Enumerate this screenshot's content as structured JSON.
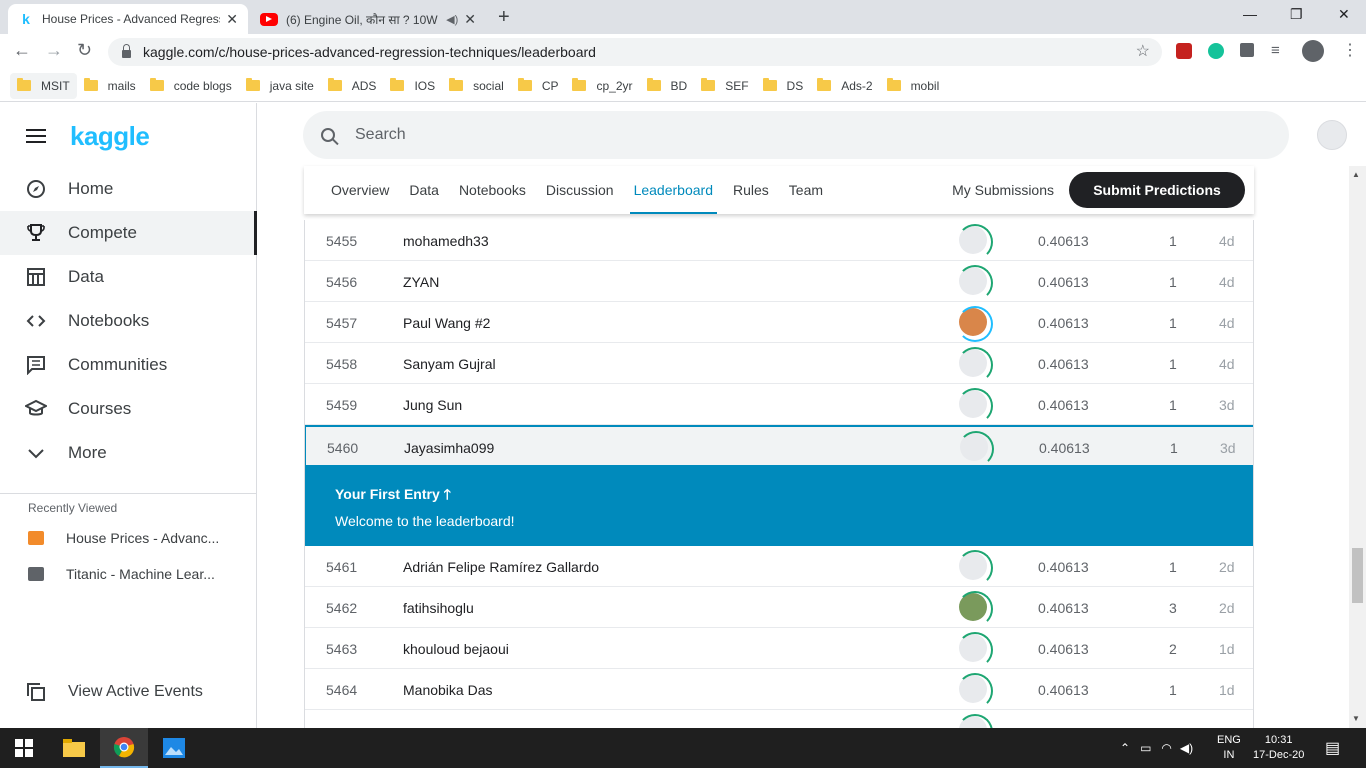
{
  "browser": {
    "tabs": [
      {
        "title": "House Prices - Advanced Regress",
        "favicon": "kaggle-k-icon",
        "active": true
      },
      {
        "title": "(6) Engine Oil, कौन सा ? 10W",
        "favicon": "youtube-icon",
        "active": false
      }
    ],
    "url": "kaggle.com/c/house-prices-advanced-regression-techniques/leaderboard",
    "bookmarks": [
      "MSIT",
      "mails",
      "code blogs",
      "java site",
      "ADS",
      "IOS",
      "social",
      "CP",
      "cp_2yr",
      "BD",
      "SEF",
      "DS",
      "Ads-2",
      "mobil"
    ]
  },
  "sidebar": {
    "logo": "kaggle",
    "items": [
      {
        "label": "Home",
        "icon": "compass-icon"
      },
      {
        "label": "Compete",
        "icon": "trophy-icon",
        "selected": true
      },
      {
        "label": "Data",
        "icon": "table-icon"
      },
      {
        "label": "Notebooks",
        "icon": "code-icon"
      },
      {
        "label": "Communities",
        "icon": "forum-icon"
      },
      {
        "label": "Courses",
        "icon": "school-icon"
      },
      {
        "label": "More",
        "icon": "chevron-down-icon"
      }
    ],
    "recently_viewed_heading": "Recently Viewed",
    "recent": [
      "House Prices - Advanc...",
      "Titanic - Machine Lear..."
    ],
    "view_active_events": "View Active Events"
  },
  "search": {
    "placeholder": "Search"
  },
  "competition_tabs": [
    "Overview",
    "Data",
    "Notebooks",
    "Discussion",
    "Leaderboard",
    "Rules",
    "Team"
  ],
  "active_tab": "Leaderboard",
  "my_submissions": "My Submissions",
  "submit_predictions": "Submit Predictions",
  "leaderboard": {
    "rows_before": [
      {
        "rank": "5455",
        "name": "mohamedh33",
        "score": "0.40613",
        "entries": "1",
        "last": "4d",
        "avatar": "default"
      },
      {
        "rank": "5456",
        "name": "ZYAN",
        "score": "0.40613",
        "entries": "1",
        "last": "4d",
        "avatar": "default"
      },
      {
        "rank": "5457",
        "name": "Paul Wang #2",
        "score": "0.40613",
        "entries": "1",
        "last": "4d",
        "avatar": "shiba"
      },
      {
        "rank": "5458",
        "name": "Sanyam Gujral",
        "score": "0.40613",
        "entries": "1",
        "last": "4d",
        "avatar": "default"
      },
      {
        "rank": "5459",
        "name": "Jung Sun",
        "score": "0.40613",
        "entries": "1",
        "last": "3d",
        "avatar": "default"
      }
    ],
    "my_row": {
      "rank": "5460",
      "name": "Jayasimha099",
      "score": "0.40613",
      "entries": "1",
      "last": "3d",
      "avatar": "default"
    },
    "first_entry": {
      "title": "Your First Entry",
      "message": "Welcome to the leaderboard!"
    },
    "rows_after": [
      {
        "rank": "5461",
        "name": "Adrián Felipe Ramírez Gallardo",
        "score": "0.40613",
        "entries": "1",
        "last": "2d",
        "avatar": "default"
      },
      {
        "rank": "5462",
        "name": "fatihsihoglu",
        "score": "0.40613",
        "entries": "3",
        "last": "2d",
        "avatar": "photo"
      },
      {
        "rank": "5463",
        "name": "khouloud bejaoui",
        "score": "0.40613",
        "entries": "2",
        "last": "1d",
        "avatar": "default"
      },
      {
        "rank": "5464",
        "name": "Manobika Das",
        "score": "0.40613",
        "entries": "1",
        "last": "1d",
        "avatar": "default"
      }
    ]
  },
  "taskbar": {
    "lang1": "ENG",
    "lang2": "IN",
    "time": "10:31",
    "date": "17-Dec-20"
  },
  "colors": {
    "accent": "#008abc",
    "kaggle_blue": "#20beff",
    "dark": "#202124"
  }
}
